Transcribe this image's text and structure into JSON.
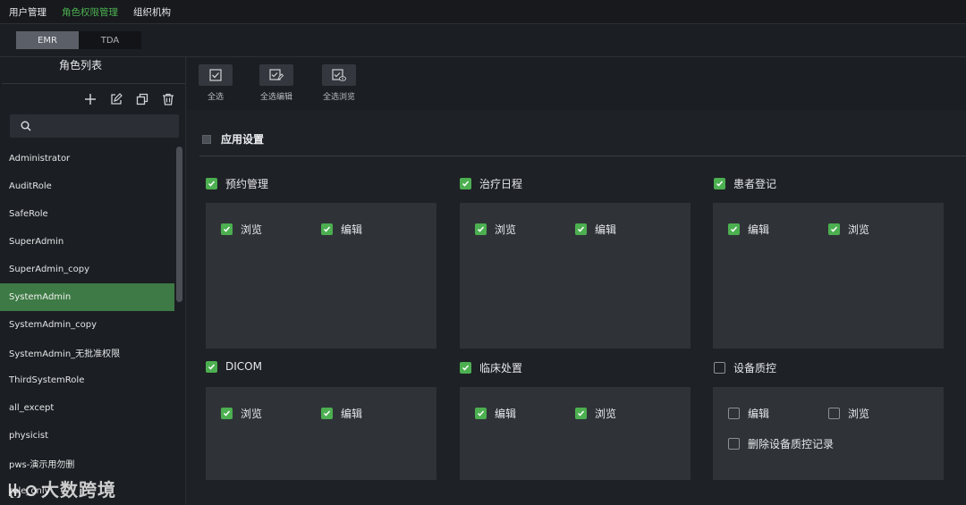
{
  "topnav": {
    "items": [
      "用户管理",
      "角色权限管理",
      "组织机构"
    ],
    "active_index": 1
  },
  "systabs": {
    "items": [
      "EMR",
      "TDA"
    ],
    "active_index": 0
  },
  "left": {
    "title": "角色列表",
    "tools": [
      "plus-icon",
      "edit-icon",
      "copy-icon",
      "trash-icon"
    ],
    "search": {
      "value": "",
      "placeholder": ""
    },
    "roles": [
      "Administrator",
      "AuditRole",
      "SafeRole",
      "SuperAdmin",
      "SuperAdmin_copy",
      "SystemAdmin",
      "SystemAdmin_copy",
      "SystemAdmin_无批准权限",
      "ThirdSystemRole",
      "all_except",
      "physicist",
      "pws-演示用勿删",
      "rule_only"
    ],
    "active_role_index": 5
  },
  "toolbar": {
    "select_all": "全选",
    "select_all_edit": "全选编辑",
    "select_all_browse": "全选浏览"
  },
  "section": {
    "label": "应用设置"
  },
  "groups": [
    {
      "label": "预约管理",
      "checked": true,
      "perms": [
        {
          "label": "浏览",
          "checked": true
        },
        {
          "label": "编辑",
          "checked": true
        }
      ]
    },
    {
      "label": "治疗日程",
      "checked": true,
      "perms": [
        {
          "label": "浏览",
          "checked": true
        },
        {
          "label": "编辑",
          "checked": true
        }
      ]
    },
    {
      "label": "患者登记",
      "checked": true,
      "perms": [
        {
          "label": "编辑",
          "checked": true
        },
        {
          "label": "浏览",
          "checked": true
        }
      ]
    },
    {
      "label": "DICOM",
      "checked": true,
      "perms": [
        {
          "label": "浏览",
          "checked": true
        },
        {
          "label": "编辑",
          "checked": true
        }
      ]
    },
    {
      "label": "临床处置",
      "checked": true,
      "perms": [
        {
          "label": "编辑",
          "checked": true
        },
        {
          "label": "浏览",
          "checked": true
        }
      ]
    },
    {
      "label": "设备质控",
      "checked": false,
      "perms": [
        {
          "label": "编辑",
          "checked": false
        },
        {
          "label": "浏览",
          "checked": false
        },
        {
          "label": "删除设备质控记录",
          "checked": false
        }
      ]
    }
  ],
  "watermark": "大数跨境",
  "colors": {
    "accent": "#4caf50",
    "active_row": "#3e7a45",
    "card": "#2f3338"
  }
}
